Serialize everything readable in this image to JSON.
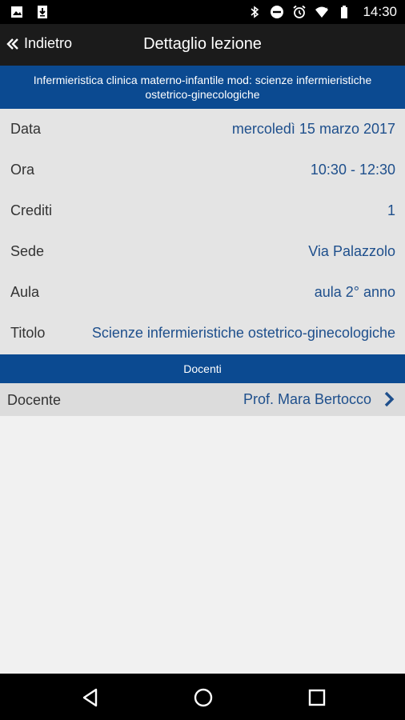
{
  "status_bar": {
    "time": "14:30",
    "left_icons": [
      "image-icon",
      "download-icon"
    ],
    "right_icons": [
      "bluetooth-icon",
      "do-not-disturb-icon",
      "alarm-icon",
      "wifi-icon",
      "battery-icon"
    ]
  },
  "nav": {
    "back_label": "Indietro",
    "title": "Dettaglio lezione"
  },
  "course": {
    "line1": "Infermieristica clinica materno-infantile  mod: scienze infermieristiche",
    "line2": "ostetrico-ginecologiche"
  },
  "details": {
    "data": {
      "label": "Data",
      "value": "mercoledì 15 marzo 2017"
    },
    "ora": {
      "label": "Ora",
      "value": "10:30 - 12:30"
    },
    "crediti": {
      "label": "Crediti",
      "value": "1"
    },
    "sede": {
      "label": "Sede",
      "value": "Via Palazzolo"
    },
    "aula": {
      "label": "Aula",
      "value": "aula 2° anno"
    },
    "titolo": {
      "label": "Titolo",
      "value": "Scienze infermieristiche ostetrico-ginecologiche"
    }
  },
  "docenti": {
    "section_title": "Docenti",
    "label": "Docente",
    "value": "Prof. Mara Bertocco"
  },
  "colors": {
    "accent_blue": "#0b4a91",
    "value_text": "#1e4f8c",
    "navbar_bg": "#1b1b1b"
  }
}
